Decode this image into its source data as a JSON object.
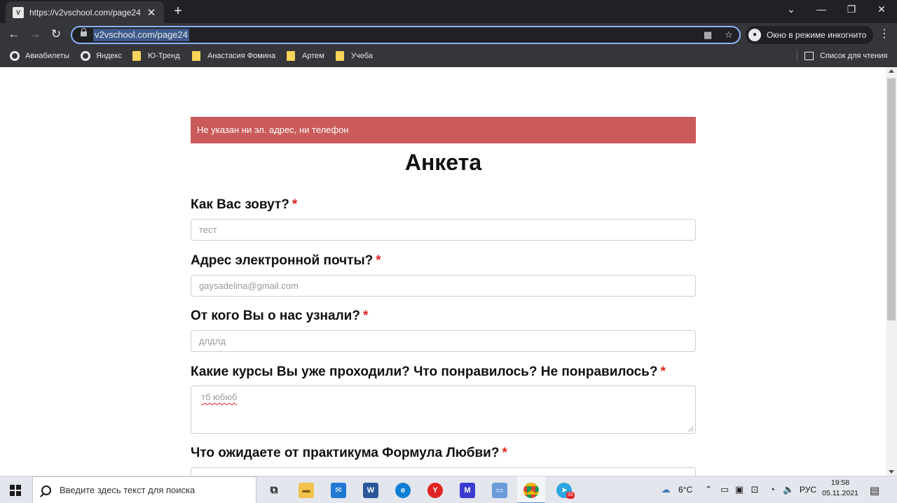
{
  "browser": {
    "tab_title": "https://v2vschool.com/page24",
    "url": "v2vschool.com/page24",
    "incognito_label": "Окно в режиме инкогнито",
    "bookmarks": [
      {
        "label": "Авиабилеты",
        "icon": "globe-icon"
      },
      {
        "label": "Яндекс",
        "icon": "globe-icon"
      },
      {
        "label": "Ю-Тренд",
        "icon": "folder-icon"
      },
      {
        "label": "Анастасия Фомина",
        "icon": "folder-icon"
      },
      {
        "label": "Артем",
        "icon": "folder-icon"
      },
      {
        "label": "Учеба",
        "icon": "folder-icon"
      }
    ],
    "reading_list": "Список для чтения"
  },
  "page": {
    "alert": "Не указан ни эл. адрес, ни телефон",
    "title": "Анкета",
    "required_mark": "*",
    "fields": [
      {
        "label": "Как Вас зовут?",
        "value": "тест"
      },
      {
        "label": "Адрес электронной почты?",
        "value": "gaysadelina@gmail.com"
      },
      {
        "label": "От кого Вы о нас узнали?",
        "value": "длдлд"
      },
      {
        "label": "Какие курсы Вы уже проходили? Что понравилось? Не понравилось?",
        "value": "тб юбюб"
      },
      {
        "label": "Что ожидаете от практикума Формула Любви?",
        "value": ""
      }
    ]
  },
  "taskbar": {
    "search_placeholder": "Введите здесь текст для поиска",
    "weather": "6°C",
    "language": "РУС",
    "time": "19:58",
    "date": "05.11.2021",
    "telegram_badge": "33",
    "colors": {
      "word": "#2b579a",
      "edge": "#0f7fd4",
      "yandex": "#e02424",
      "vs": "#3b3bd1",
      "telegram": "#2ca5e0"
    }
  }
}
